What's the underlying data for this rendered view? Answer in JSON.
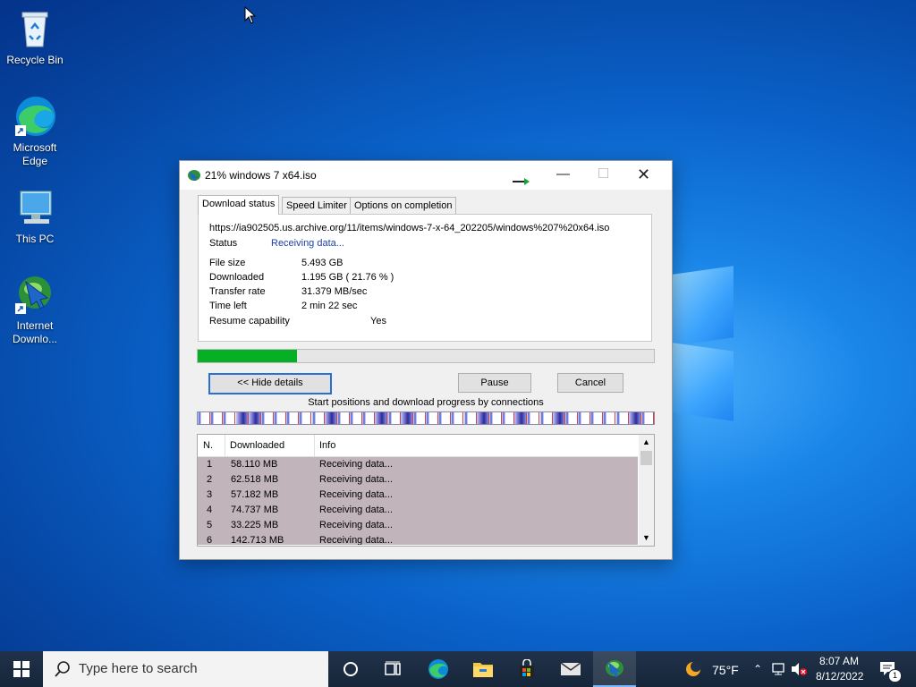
{
  "desktop": {
    "icons": [
      {
        "label": "Recycle Bin"
      },
      {
        "label": "Microsoft Edge"
      },
      {
        "label": "This PC"
      },
      {
        "label": "Internet Downlo..."
      }
    ]
  },
  "window": {
    "title": "21% windows 7 x64.iso",
    "tabs": [
      "Download status",
      "Speed Limiter",
      "Options on completion"
    ],
    "url": "https://ia902505.us.archive.org/11/items/windows-7-x-64_202205/windows%207%20x64.iso",
    "status_label": "Status",
    "status_value": "Receiving data...",
    "details": [
      {
        "label": "File size",
        "value": "5.493  GB"
      },
      {
        "label": "Downloaded",
        "value": "1.195  GB  ( 21.76 % )"
      },
      {
        "label": "Transfer rate",
        "value": "31.379  MB/sec"
      },
      {
        "label": "Time left",
        "value": "2 min 22 sec"
      },
      {
        "label": "Resume capability",
        "value": "Yes"
      }
    ],
    "progress": 0.2176,
    "buttons": {
      "hide_details": "<< Hide details",
      "pause": "Pause",
      "cancel": "Cancel"
    },
    "connections_title": "Start positions and download progress by connections",
    "columns": [
      "N.",
      "Downloaded",
      "Info"
    ],
    "connections": [
      {
        "n": "1",
        "downloaded": "58.110  MB",
        "info": "Receiving data..."
      },
      {
        "n": "2",
        "downloaded": "62.518  MB",
        "info": "Receiving data..."
      },
      {
        "n": "3",
        "downloaded": "57.182  MB",
        "info": "Receiving data..."
      },
      {
        "n": "4",
        "downloaded": "74.737  MB",
        "info": "Receiving data..."
      },
      {
        "n": "5",
        "downloaded": "33.225  MB",
        "info": "Receiving data..."
      },
      {
        "n": "6",
        "downloaded": "142.713  MB",
        "info": "Receiving data..."
      }
    ]
  },
  "taskbar": {
    "search_placeholder": "Type here to search",
    "weather": "75°F",
    "time": "8:07 AM",
    "date": "8/12/2022",
    "notification_count": "1"
  },
  "colors": {
    "progress": "#06b025",
    "accent": "#2b6fd4"
  }
}
